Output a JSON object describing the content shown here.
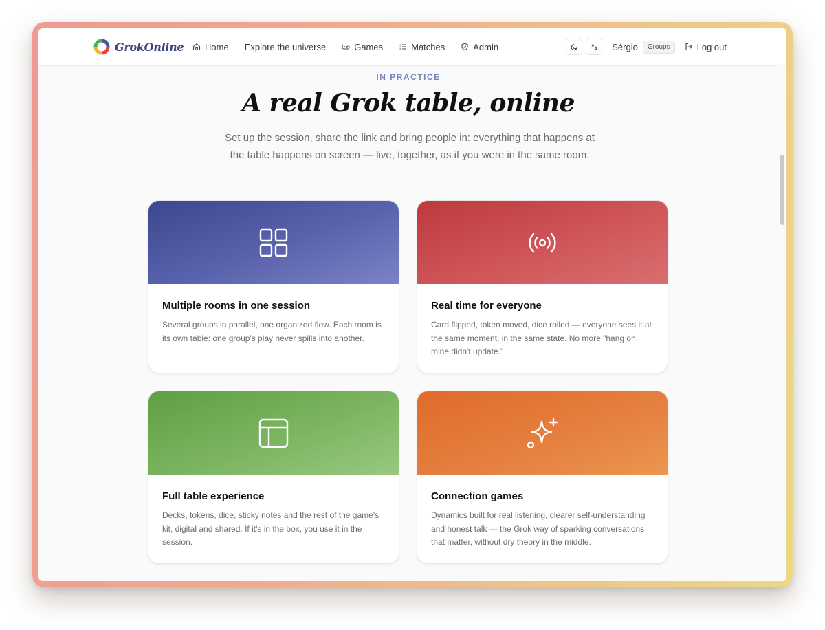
{
  "app": {
    "name": "GrokOnline"
  },
  "nav": {
    "items": [
      {
        "label": "Home",
        "icon": "home-icon"
      },
      {
        "label": "Explore the universe",
        "icon": ""
      },
      {
        "label": "Games",
        "icon": "gamepad-icon"
      },
      {
        "label": "Matches",
        "icon": "list-icon"
      },
      {
        "label": "Admin",
        "icon": "shield-icon"
      }
    ]
  },
  "toolbar": {
    "theme_icon": "moon-icon",
    "language_icon": "translate-icon",
    "user_name": "Sérgio",
    "user_badge": "Groups",
    "logout_label": "Log out"
  },
  "hero": {
    "eyebrow": "IN PRACTICE",
    "title": "A real Grok table, online",
    "subtitle": "Set up the session, share the link and bring people in: everything that happens at the table happens on screen — live, together, as if you were in the same room."
  },
  "cards": [
    {
      "title": "Multiple rooms in one session",
      "text": "Several groups in parallel, one organized flow. Each room is its own table: one group's play never spills into another.",
      "icon": "grid-icon",
      "color": "#4a52a0"
    },
    {
      "title": "Real time for everyone",
      "text": "Card flipped, token moved, dice rolled — everyone sees it at the same moment, in the same state. No more \"hang on, mine didn't update.\"",
      "icon": "broadcast-icon",
      "color": "#c94a4d"
    },
    {
      "title": "Full table experience",
      "text": "Decks, tokens, dice, sticky notes and the rest of the game's kit, digital and shared. If it's in the box, you use it in the session.",
      "icon": "table-icon",
      "color": "#74ae58"
    },
    {
      "title": "Connection games",
      "text": "Dynamics built for real listening, clearer self-understanding and honest talk — the Grok way of sparking conversations that matter, without dry theory in the middle.",
      "icon": "sparkle-icon",
      "color": "#e47a3a"
    }
  ]
}
